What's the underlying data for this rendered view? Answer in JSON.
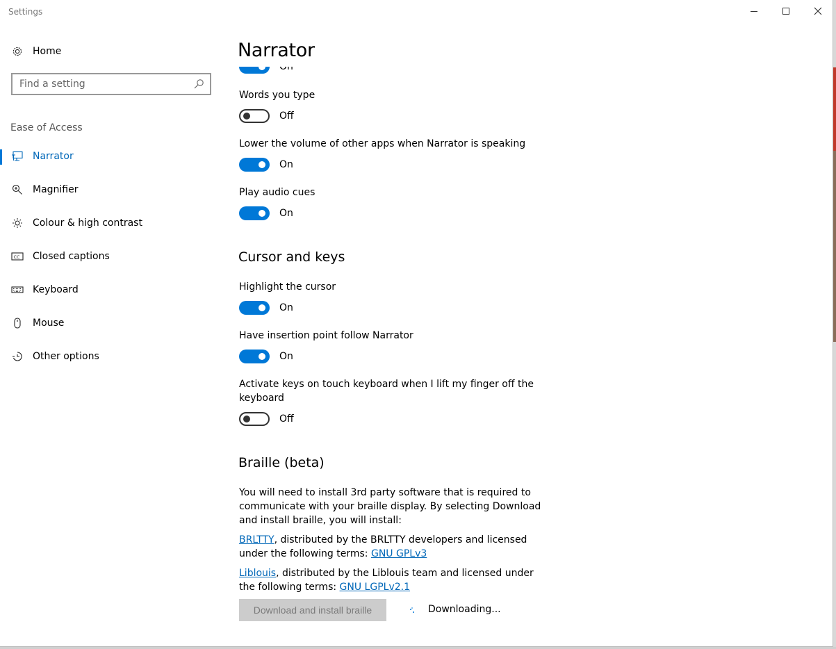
{
  "window": {
    "title": "Settings"
  },
  "sidebar": {
    "home_label": "Home",
    "search_placeholder": "Find a setting",
    "category": "Ease of Access",
    "items": [
      {
        "label": "Narrator",
        "icon": "narrator-icon",
        "active": true
      },
      {
        "label": "Magnifier",
        "icon": "magnifier-icon",
        "active": false
      },
      {
        "label": "Colour & high contrast",
        "icon": "brightness-icon",
        "active": false
      },
      {
        "label": "Closed captions",
        "icon": "closed-captions-icon",
        "active": false
      },
      {
        "label": "Keyboard",
        "icon": "keyboard-icon",
        "active": false
      },
      {
        "label": "Mouse",
        "icon": "mouse-icon",
        "active": false
      },
      {
        "label": "Other options",
        "icon": "other-options-icon",
        "active": false
      }
    ]
  },
  "main": {
    "title": "Narrator",
    "partial_toggle_state": "On",
    "settings_top": [
      {
        "label": "Words you type",
        "state": "Off",
        "on": false
      },
      {
        "label": "Lower the volume of other apps when Narrator is speaking",
        "state": "On",
        "on": true
      },
      {
        "label": "Play audio cues",
        "state": "On",
        "on": true
      }
    ],
    "cursor_section": {
      "heading": "Cursor and keys",
      "settings": [
        {
          "label": "Highlight the cursor",
          "state": "On",
          "on": true
        },
        {
          "label": "Have insertion point follow Narrator",
          "state": "On",
          "on": true
        },
        {
          "label": "Activate keys on touch keyboard when I lift my finger off the keyboard",
          "state": "Off",
          "on": false
        }
      ]
    },
    "braille_section": {
      "heading": "Braille (beta)",
      "intro": "You will need to install 3rd party software that is required to communicate with your braille display. By selecting Download and install braille, you will install:",
      "brltty": {
        "link": "BRLTTY",
        "text": ", distributed by the BRLTTY developers and licensed under the following terms: ",
        "license_link": "GNU GPLv3"
      },
      "liblouis": {
        "link": "Liblouis",
        "text": ", distributed by the Liblouis team and licensed under the following terms: ",
        "license_link": "GNU LGPLv2.1"
      },
      "button_label": "Download and install braille",
      "status": "Downloading..."
    }
  },
  "colors": {
    "accent": "#0078d7",
    "link": "#0067b8"
  }
}
